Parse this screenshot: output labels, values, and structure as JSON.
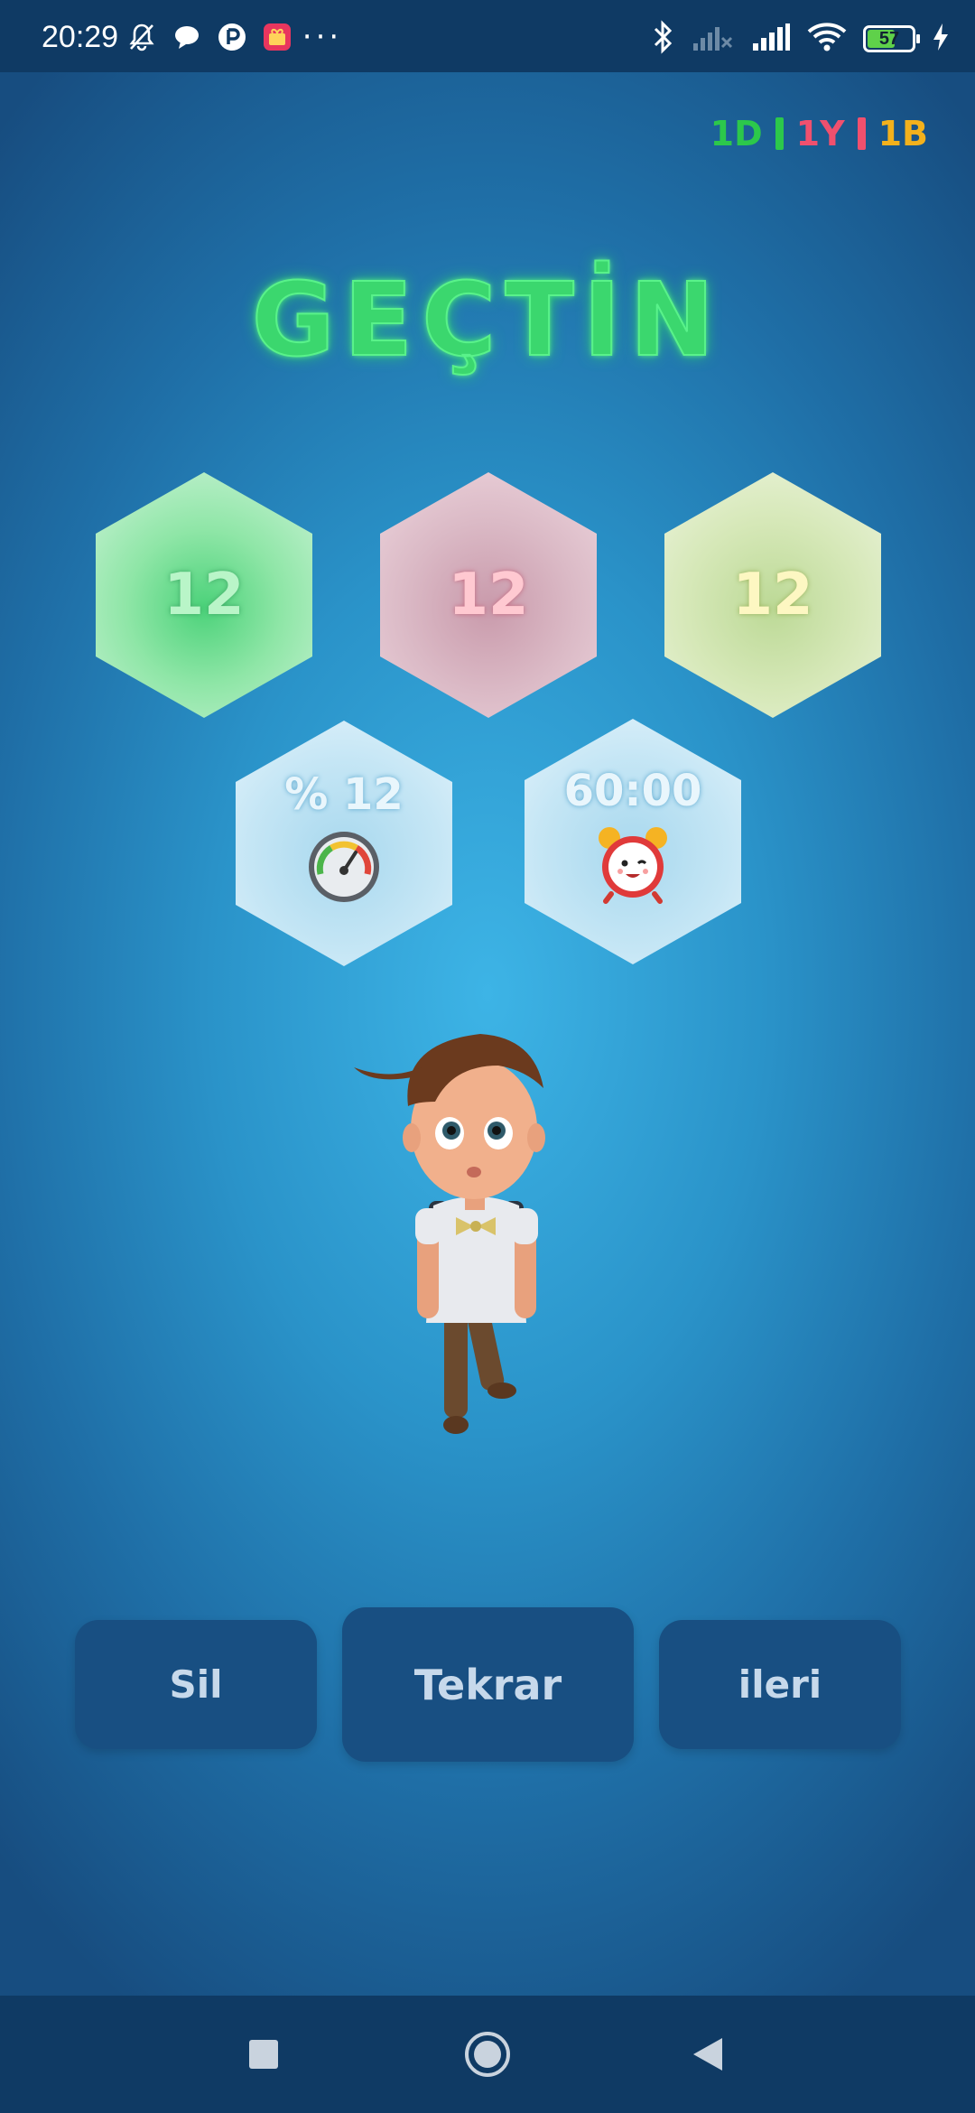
{
  "status_bar": {
    "time": "20:29",
    "battery": "57",
    "icons": [
      "bell-off-icon",
      "chat-icon",
      "p-app-icon",
      "gift-app-icon",
      "more-dots-icon",
      "bluetooth-icon",
      "signal-off-icon",
      "signal-icon",
      "wifi-icon",
      "battery-icon",
      "charging-icon"
    ]
  },
  "counters": {
    "correct": "1D",
    "wrong": "1Y",
    "blank": "1B",
    "colors": {
      "correct": "#2cc84b",
      "wrong": "#f0506e",
      "blank": "#f3b11c"
    }
  },
  "title": "GEÇTİN",
  "stats": {
    "correct_count": "12",
    "wrong_count": "12",
    "blank_count": "12",
    "percent": "% 12",
    "time": "60:00"
  },
  "buttons": {
    "delete": "Sil",
    "repeat": "Tekrar",
    "next": "ileri"
  },
  "nav": {
    "icons": [
      "square-icon",
      "circle-icon",
      "back-triangle-icon"
    ]
  }
}
